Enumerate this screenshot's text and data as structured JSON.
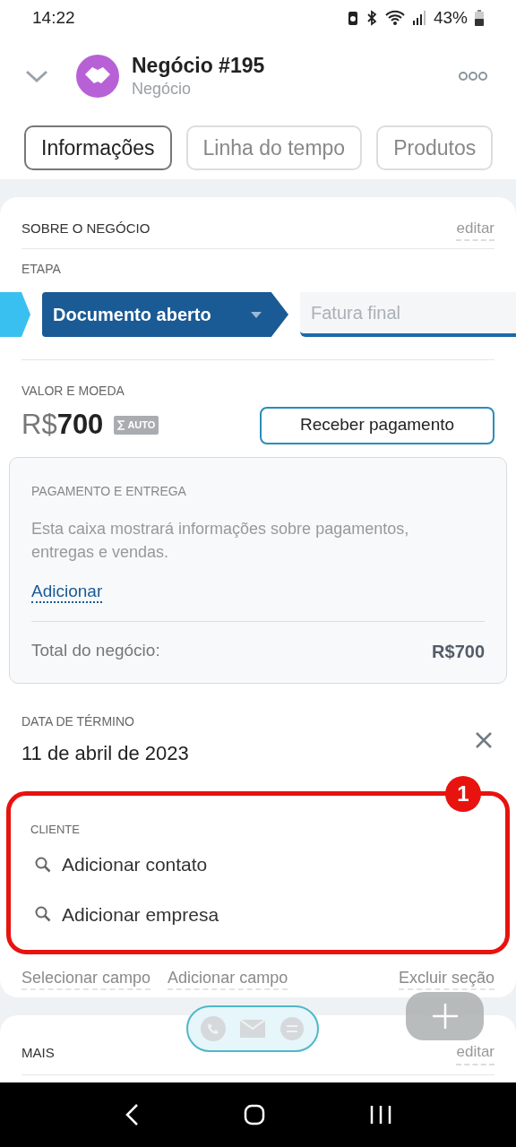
{
  "status_bar": {
    "time": "14:22",
    "battery": "43%"
  },
  "header": {
    "title": "Negócio #195",
    "subtitle": "Negócio"
  },
  "tabs": [
    {
      "label": "Informações",
      "selected": true
    },
    {
      "label": "Linha do tempo",
      "selected": false
    },
    {
      "label": "Produtos",
      "selected": false
    }
  ],
  "about": {
    "title": "SOBRE O NEGÓCIO",
    "edit": "editar",
    "stage_label": "ETAPA",
    "stages": [
      {
        "label": "Documento aberto",
        "selected": true
      },
      {
        "label": "Fatura final",
        "selected": false
      }
    ],
    "value_label": "VALOR E MOEDA",
    "currency": "R$",
    "amount": "700",
    "auto_badge": "AUTO",
    "receive_button": "Receber pagamento",
    "payment": {
      "title": "PAGAMENTO E ENTREGA",
      "description": "Esta caixa mostrará informações sobre pagamentos, entregas e vendas.",
      "add_link": "Adicionar",
      "total_label": "Total do negócio:",
      "total_value": "R$700"
    },
    "end_date_label": "DATA DE TÉRMINO",
    "end_date": "11 de abril de 2023",
    "client": {
      "title": "CLIENTE",
      "badge": "1",
      "items": [
        "Adicionar contato",
        "Adicionar empresa"
      ]
    },
    "footer_links": [
      "Selecionar campo",
      "Adicionar campo",
      "Excluir seção"
    ]
  },
  "more": {
    "title": "MAIS",
    "edit": "editar"
  }
}
